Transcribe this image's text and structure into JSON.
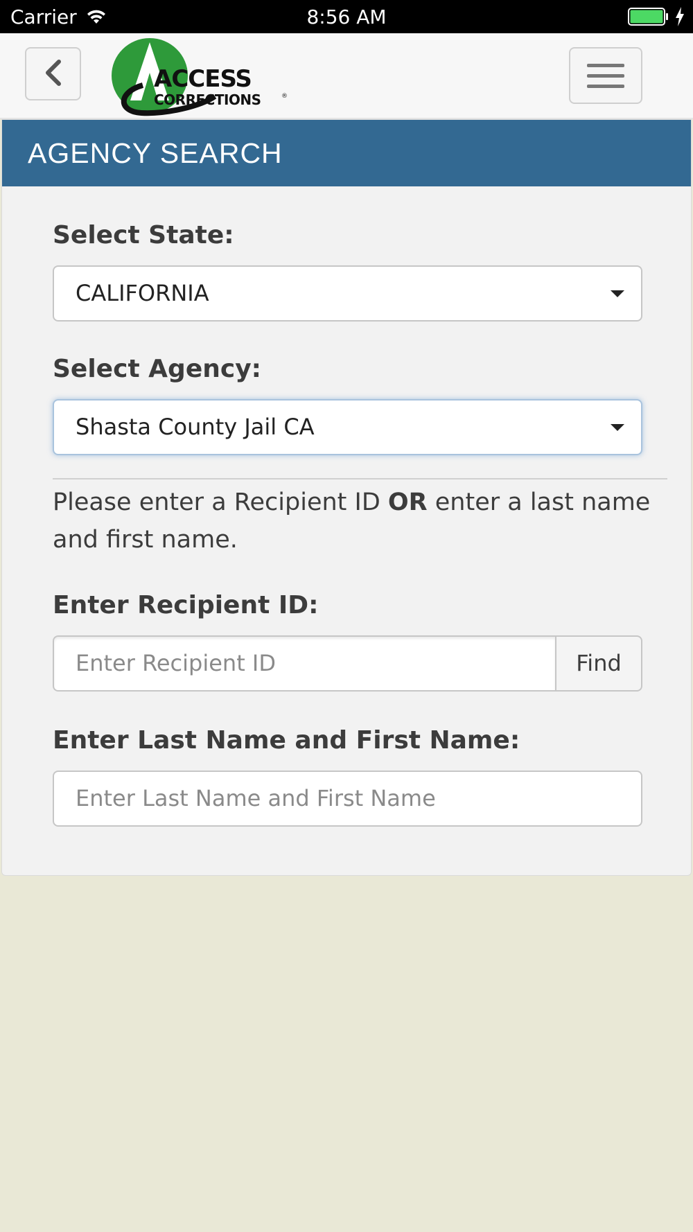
{
  "status_bar": {
    "carrier": "Carrier",
    "time": "8:56 AM",
    "battery_color": "#4cd964"
  },
  "header": {
    "back_icon": "chevron-left-icon",
    "logo_text_top": "ACCESS",
    "logo_text_bottom": "CORRECTIONS",
    "logo_green": "#2e9a3a",
    "menu_icon": "hamburger-icon"
  },
  "panel": {
    "title": "AGENCY SEARCH",
    "title_bg": "#336992"
  },
  "form": {
    "state_label": "Select State:",
    "state_value": "CALIFORNIA",
    "agency_label": "Select Agency:",
    "agency_value": "Shasta County Jail CA",
    "info_prefix": "Please enter a Recipient ID ",
    "info_bold": "OR",
    "info_suffix": " enter a last name and first name.",
    "recipient_label": "Enter Recipient ID:",
    "recipient_placeholder": "Enter Recipient ID",
    "find_label": "Find",
    "name_label": "Enter Last Name and First Name:",
    "name_placeholder": "Enter Last Name and First Name"
  }
}
